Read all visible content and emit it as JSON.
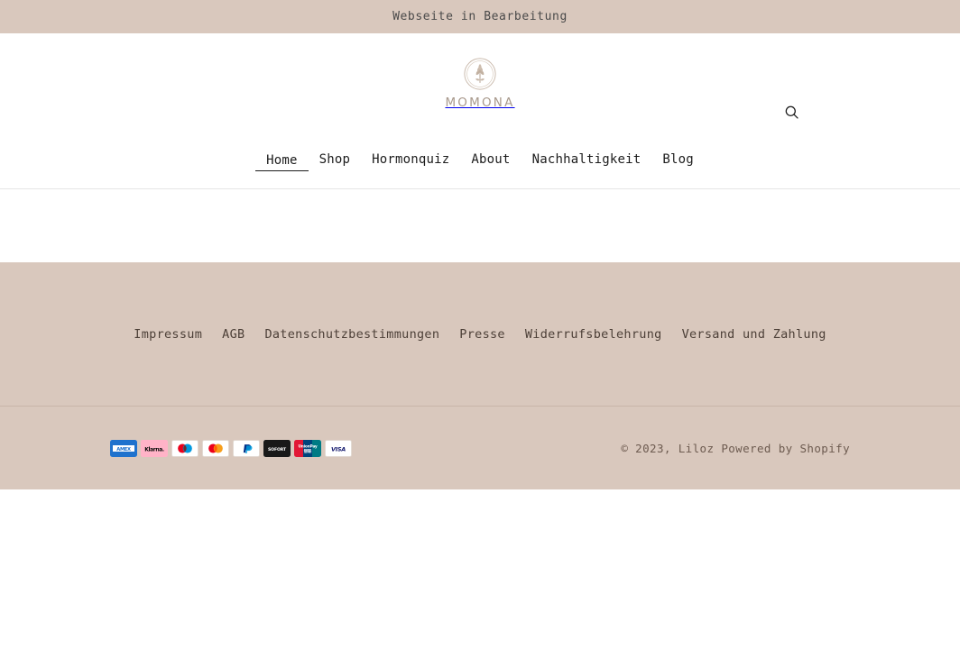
{
  "announcement": {
    "text": "Webseite in Bearbeitung"
  },
  "header": {
    "logo": {
      "icon": "wheat-circle-emblem",
      "wordmark": "MOMONA"
    },
    "search": {
      "icon": "search-icon",
      "label": "Suche"
    },
    "nav": [
      {
        "label": "Home",
        "active": true
      },
      {
        "label": "Shop",
        "active": false
      },
      {
        "label": "Hormonquiz",
        "active": false
      },
      {
        "label": "About",
        "active": false
      },
      {
        "label": "Nachhaltigkeit",
        "active": false
      },
      {
        "label": "Blog",
        "active": false
      }
    ]
  },
  "footer": {
    "links": [
      {
        "label": "Impressum"
      },
      {
        "label": "AGB"
      },
      {
        "label": "Datenschutzbestimmungen"
      },
      {
        "label": "Presse"
      },
      {
        "label": "Widerrufsbelehrung"
      },
      {
        "label": "Versand und Zahlung"
      }
    ],
    "payment_methods": [
      {
        "name": "american-express",
        "label": "AMEX"
      },
      {
        "name": "klarna",
        "label": "Klarna."
      },
      {
        "name": "maestro",
        "label": "Maestro"
      },
      {
        "name": "mastercard",
        "label": "Mastercard"
      },
      {
        "name": "paypal",
        "label": "PayPal"
      },
      {
        "name": "sofort",
        "label": "SOFORT"
      },
      {
        "name": "unionpay",
        "label": "UnionPay"
      },
      {
        "name": "visa",
        "label": "VISA"
      }
    ],
    "copyright": {
      "prefix": "© 2023,",
      "shop_name": "Liloz",
      "powered_by": "Powered by Shopify"
    }
  },
  "colors": {
    "announcement_bg": "#d9c8bd",
    "footer_bg": "#d9c8bd",
    "page_bg": "#ffffff",
    "nav_text": "#1c1c1c",
    "footer_text": "#4d4038",
    "logo_wordmark": "#a8998c"
  }
}
